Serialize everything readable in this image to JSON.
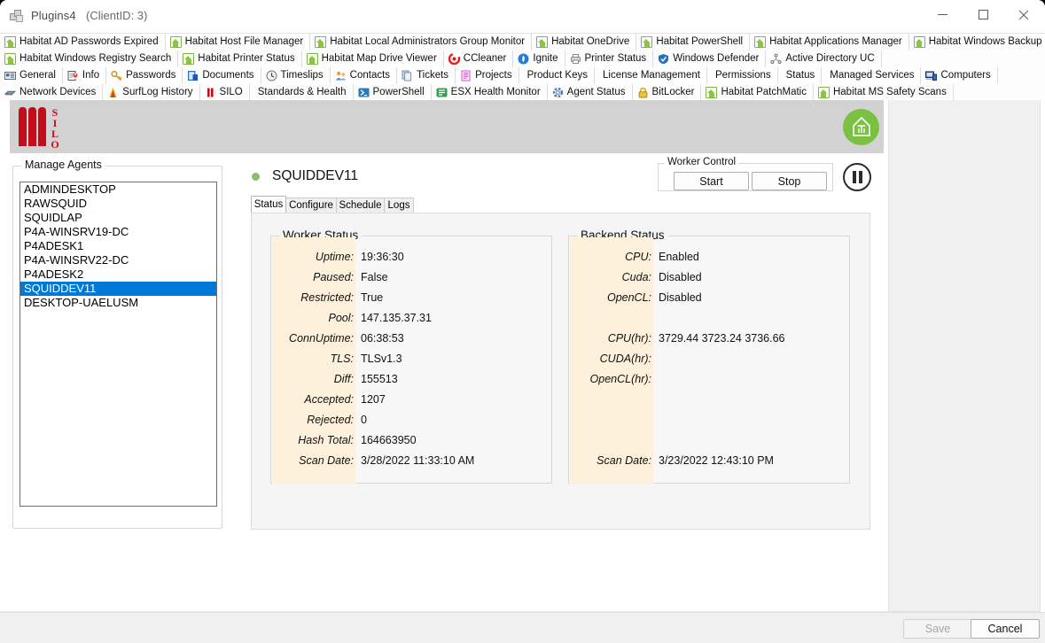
{
  "window": {
    "title": "Plugins4",
    "client_id": "(ClientID: 3)",
    "icon": "plugins-icon",
    "minimize_label": "–",
    "maximize_label": "□",
    "close_label": "✕"
  },
  "toolbar_rows": [
    [
      {
        "label": "Habitat AD Passwords Expired",
        "icon": "house-icon"
      },
      {
        "label": "Habitat Host File Manager",
        "icon": "house-icon"
      },
      {
        "label": "Habitat Local Administrators Group Monitor",
        "icon": "house-icon"
      },
      {
        "label": "Habitat OneDrive",
        "icon": "house-icon"
      },
      {
        "label": "Habitat PowerShell",
        "icon": "house-icon"
      },
      {
        "label": "Habitat Applications Manager",
        "icon": "house-icon"
      },
      {
        "label": "Habitat Windows Backup",
        "icon": "house-icon"
      }
    ],
    [
      {
        "label": "Habitat Windows Registry Search",
        "icon": "house-icon"
      },
      {
        "label": "Habitat Printer Status",
        "icon": "house-icon"
      },
      {
        "label": "Habitat Map Drive Viewer",
        "icon": "house-icon"
      },
      {
        "label": "CCleaner",
        "icon": "ccleaner-icon"
      },
      {
        "label": "Ignite",
        "icon": "ignite-icon"
      },
      {
        "label": "Printer Status",
        "icon": "printer-icon"
      },
      {
        "label": "Windows Defender",
        "icon": "shield-icon"
      },
      {
        "label": "Active Directory UC",
        "icon": "active-directory-icon"
      }
    ],
    [
      {
        "label": "General",
        "icon": "card-icon"
      },
      {
        "label": "Info",
        "icon": "info-person-icon"
      },
      {
        "label": "Passwords",
        "icon": "key-icon"
      },
      {
        "label": "Documents",
        "icon": "documents-icon"
      },
      {
        "label": "Timeslips",
        "icon": "clock-icon"
      },
      {
        "label": "Contacts",
        "icon": "contacts-icon"
      },
      {
        "label": "Tickets",
        "icon": "tickets-icon"
      },
      {
        "label": "Projects",
        "icon": "projects-icon"
      },
      {
        "label": "Product Keys",
        "icon": "none"
      },
      {
        "label": "License Management",
        "icon": "none"
      },
      {
        "label": "Permissions",
        "icon": "none"
      },
      {
        "label": "Status",
        "icon": "none"
      },
      {
        "label": "Managed Services",
        "icon": "none"
      },
      {
        "label": "Computers",
        "icon": "computers-icon"
      }
    ],
    [
      {
        "label": "Network Devices",
        "icon": "network-device-icon"
      },
      {
        "label": "SurfLog History",
        "icon": "flame-icon"
      },
      {
        "label": "SILO",
        "icon": "silo-bars-icon"
      },
      {
        "label": "Standards & Health",
        "icon": "none"
      },
      {
        "label": "PowerShell",
        "icon": "powershell-icon"
      },
      {
        "label": "ESX Health Monitor",
        "icon": "esx-icon"
      },
      {
        "label": "Agent Status",
        "icon": "gear-icon"
      },
      {
        "label": "BitLocker",
        "icon": "lock-icon"
      },
      {
        "label": "Habitat PatchMatic",
        "icon": "house-icon"
      },
      {
        "label": "Habitat MS Safety Scans",
        "icon": "house-icon"
      }
    ]
  ],
  "banner": {
    "logo_text": "SILO",
    "logo_letters": [
      "S",
      "I",
      "L",
      "O"
    ],
    "badge_icon": "habitat-leaf-icon",
    "logo_color": "#c20e1a",
    "badge_color": "#7ac143"
  },
  "agents_panel": {
    "legend": "Manage Agents",
    "items": [
      "ADMINDESKTOP",
      "RAWSQUID",
      "SQUIDLAP",
      "P4A-WINSRV19-DC",
      "P4ADESK1",
      "P4A-WINSRV22-DC",
      "P4ADESK2",
      "SQUIDDEV11",
      "DESKTOP-UAELUSM"
    ],
    "selected": "SQUIDDEV11",
    "selected_index": 7,
    "selection_color": "#0078d7"
  },
  "detail": {
    "title": "SQUIDDEV11",
    "status_dot_color": "#8fbb6a",
    "tabs": [
      {
        "label": "Status",
        "active": true
      },
      {
        "label": "Configure",
        "active": false
      },
      {
        "label": "Schedule",
        "active": false
      },
      {
        "label": "Logs",
        "active": false
      }
    ]
  },
  "worker_control": {
    "legend": "Worker Control",
    "start_label": "Start",
    "stop_label": "Stop",
    "pause_icon": "pause-icon"
  },
  "worker_status": {
    "legend": "Worker Status",
    "rows": [
      {
        "key": "Uptime:",
        "value": "19:36:30"
      },
      {
        "key": "Paused:",
        "value": "False"
      },
      {
        "key": "Restricted:",
        "value": "True"
      },
      {
        "key": "Pool:",
        "value": "147.135.37.31"
      },
      {
        "key": "ConnUptime:",
        "value": "06:38:53"
      },
      {
        "key": "TLS:",
        "value": "TLSv1.3"
      },
      {
        "key": "Diff:",
        "value": "155513"
      },
      {
        "key": "Accepted:",
        "value": "1207"
      },
      {
        "key": "Rejected:",
        "value": "0"
      },
      {
        "key": "Hash Total:",
        "value": "164663950"
      },
      {
        "key": "Scan Date:",
        "value": "3/28/2022 11:33:10 AM"
      }
    ]
  },
  "backend_status": {
    "legend": "Backend Status",
    "rows": [
      {
        "key": "CPU:",
        "value": "Enabled"
      },
      {
        "key": "Cuda:",
        "value": "Disabled"
      },
      {
        "key": "OpenCL:",
        "value": "Disabled"
      },
      {
        "key": "CPU(hr):",
        "value": "3729.44 3723.24 3736.66"
      },
      {
        "key": "CUDA(hr):",
        "value": ""
      },
      {
        "key": "OpenCL(hr):",
        "value": ""
      },
      {
        "key": "Scan Date:",
        "value": "3/23/2022 12:43:10 PM"
      }
    ]
  },
  "footer": {
    "save_label": "Save",
    "save_enabled": false,
    "cancel_label": "Cancel",
    "cancel_enabled": true
  }
}
